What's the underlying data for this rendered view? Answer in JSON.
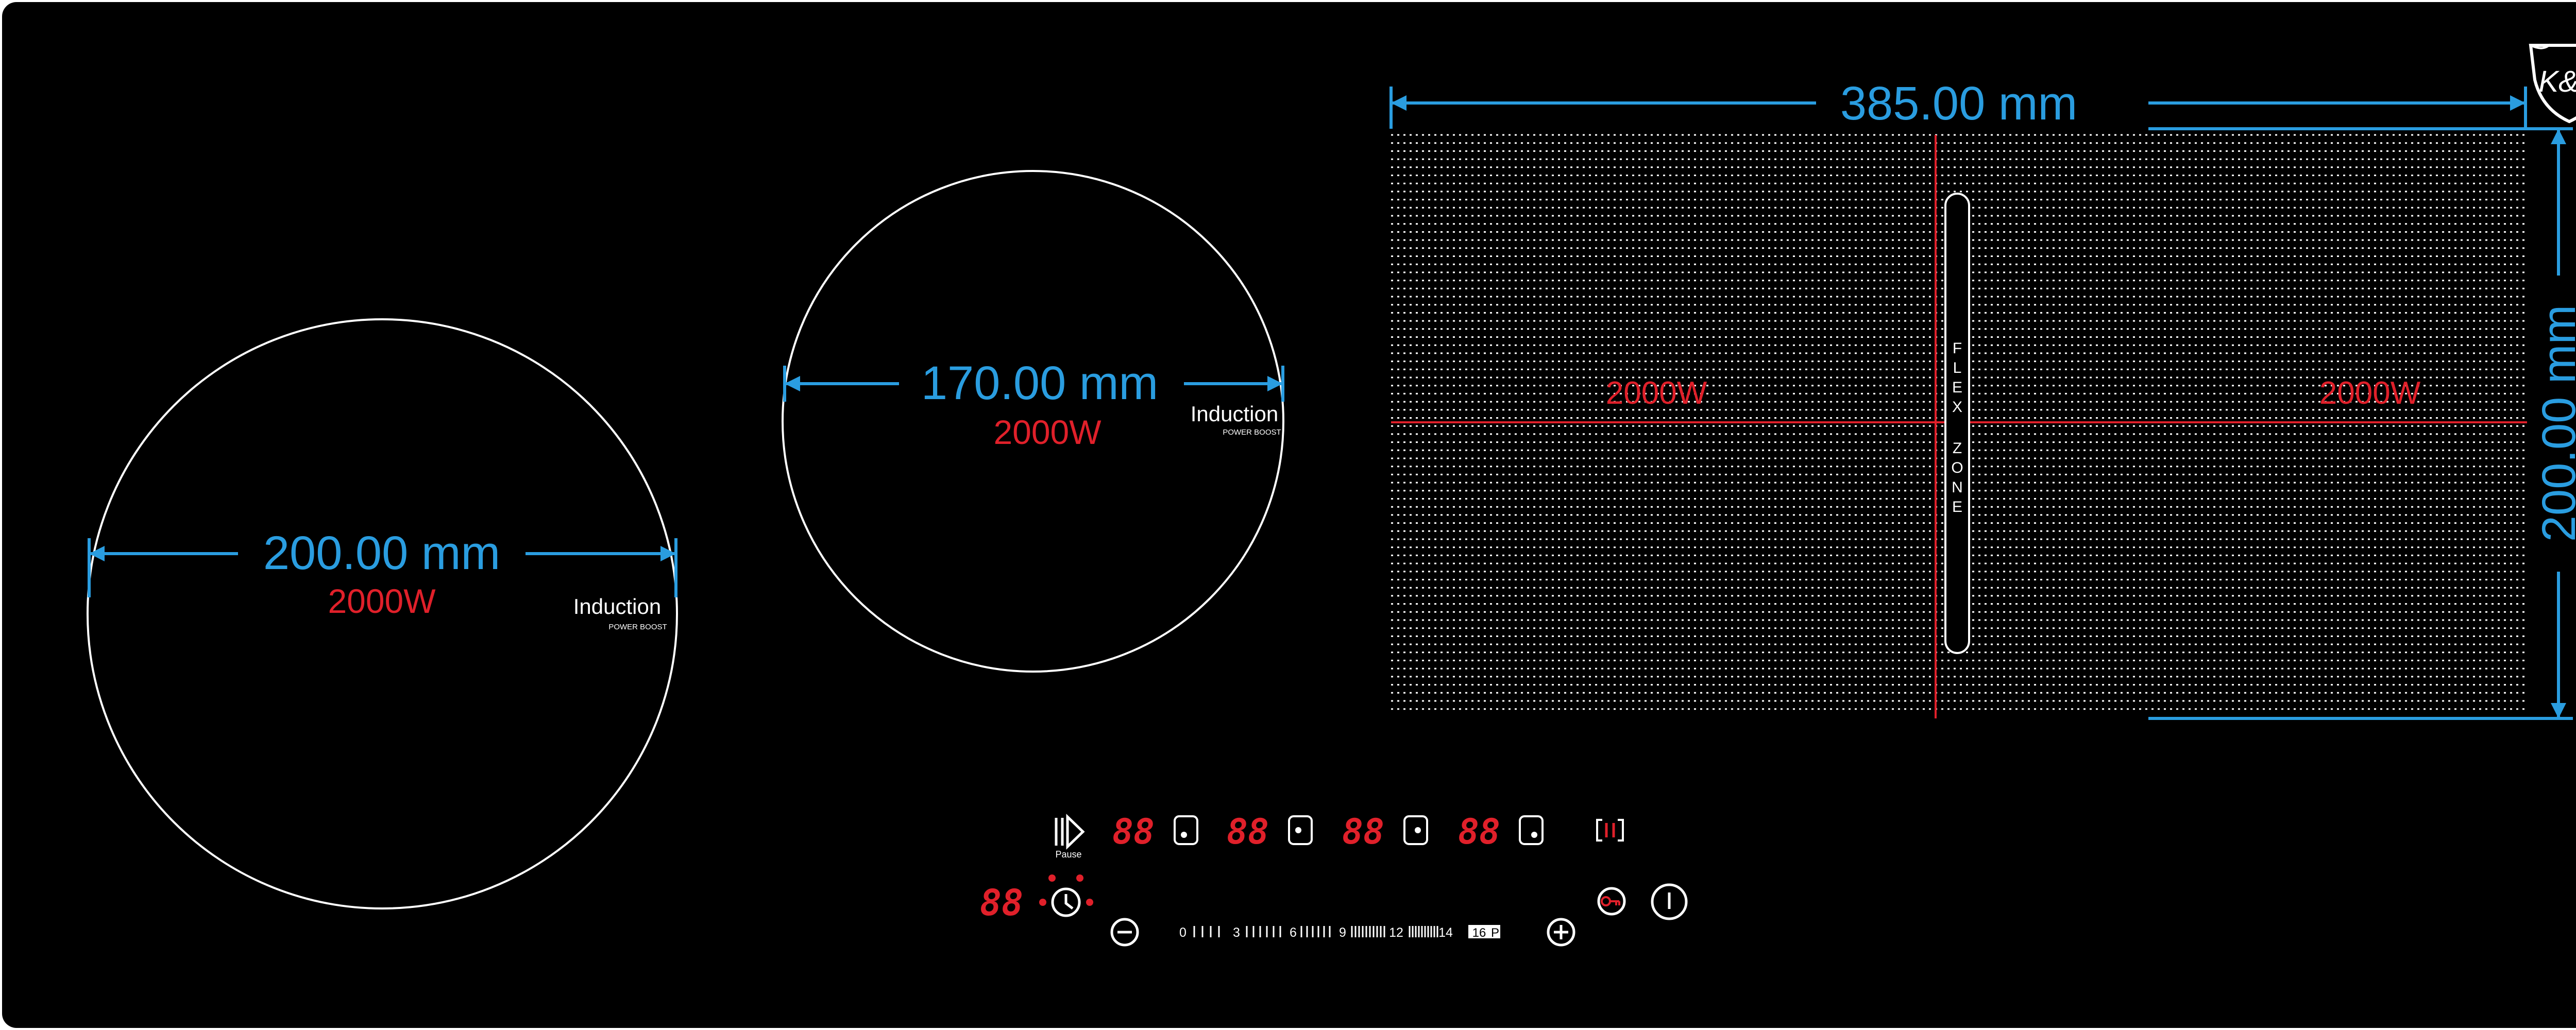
{
  "brand": {
    "logo_text": "K&H"
  },
  "zone_left": {
    "diameter_label": "200.00 mm",
    "power_label": "2000W",
    "type_label": "Induction",
    "boost_label": "POWER BOOST"
  },
  "zone_mid": {
    "diameter_label": "170.00 mm",
    "power_label": "2000W",
    "type_label": "Induction",
    "boost_label": "POWER BOOST"
  },
  "flex_zone": {
    "width_label": "385.00 mm",
    "height_label": "200.00 mm",
    "power_left": "2000W",
    "power_right": "2000W",
    "slot_text_top": [
      "F",
      "L",
      "E",
      "X"
    ],
    "slot_text_bottom": [
      "Z",
      "O",
      "N",
      "E"
    ]
  },
  "controls": {
    "pause_label": "Pause",
    "zone_displays": [
      "88",
      "88",
      "88",
      "88"
    ],
    "timer_display": "88",
    "slider_marks": [
      "0",
      "3",
      "6",
      "9",
      "12",
      "14",
      "16",
      "P"
    ]
  },
  "colors": {
    "panel": "#000000",
    "dimension_blue": "#2a9de0",
    "power_red": "#e0202a",
    "text_white": "#ffffff"
  },
  "icons": {
    "pause": "play-pause-icon",
    "timer": "clock-icon",
    "minus": "minus-circle-icon",
    "plus": "plus-circle-icon",
    "lock": "key-lock-icon",
    "power": "power-icon",
    "bridge": "flex-bridge-icon",
    "zone_select": "zone-select-icon"
  }
}
